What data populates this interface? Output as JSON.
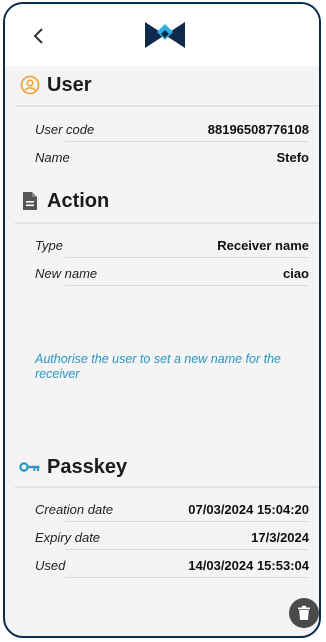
{
  "header": {
    "back_icon": "chevron-left-icon",
    "logo_icon": "brand-x-logo"
  },
  "sections": {
    "user": {
      "title": "User",
      "icon": "user-circle-icon",
      "rows": [
        {
          "label": "User code",
          "value": "88196508776108"
        },
        {
          "label": "Name",
          "value": "Stefo"
        }
      ]
    },
    "action": {
      "title": "Action",
      "icon": "document-icon",
      "rows": [
        {
          "label": "Type",
          "value": "Receiver name"
        },
        {
          "label": "New name",
          "value": "ciao"
        }
      ],
      "description": "Authorise the user to set a new name for the receiver"
    },
    "passkey": {
      "title": "Passkey",
      "icon": "key-icon",
      "rows": [
        {
          "label": "Creation date",
          "value": "07/03/2024 15:04:20"
        },
        {
          "label": "Expiry date",
          "value": "17/3/2024"
        },
        {
          "label": "Used",
          "value": "14/03/2024 15:53:04"
        }
      ]
    }
  },
  "fab": {
    "icon": "trash-icon"
  },
  "colors": {
    "accent_orange": "#f2a03c",
    "accent_blue": "#2a96c4",
    "brand_navy": "#0f2a4d"
  }
}
